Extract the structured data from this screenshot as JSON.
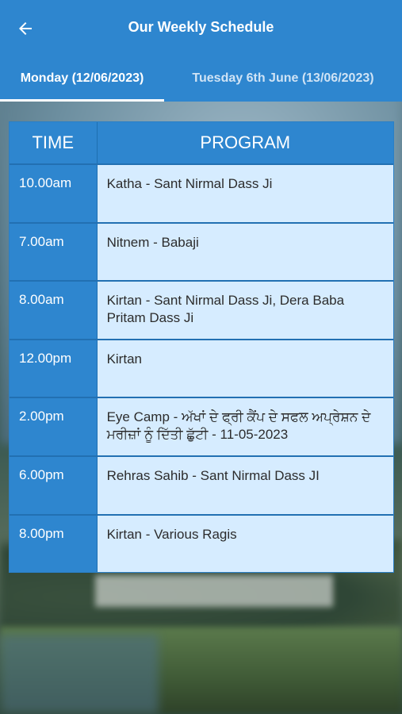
{
  "header": {
    "title": "Our Weekly Schedule",
    "back_icon": "arrow-left-icon"
  },
  "tabs": [
    {
      "label": "Monday (12/06/2023)",
      "selected": true
    },
    {
      "label": "Tuesday 6th June (13/06/2023)",
      "selected": false
    }
  ],
  "table": {
    "headers": {
      "time": "TIME",
      "program": "PROGRAM"
    },
    "rows": [
      {
        "time": "10.00am",
        "program": "Katha - Sant Nirmal Dass Ji"
      },
      {
        "time": "7.00am",
        "program": "Nitnem - Babaji"
      },
      {
        "time": "8.00am",
        "program": "Kirtan - Sant Nirmal Dass Ji, Dera Baba Pritam Dass Ji"
      },
      {
        "time": "12.00pm",
        "program": "Kirtan"
      },
      {
        "time": "2.00pm",
        "program": "Eye Camp - ਅੱਖਾਂ ਦੇ ਫ੍ਰੀ ਕੈਂਪ ਦੇ ਸਫਲ ਅਪ੍ਰੇਸ਼ਨ ਦੇ ਮਰੀਜ਼ਾਂ ਨੂੰ ਦਿੱਤੀ ਛੁੱਟੀ - 11-05-2023"
      },
      {
        "time": "6.00pm",
        "program": "Rehras Sahib - Sant Nirmal Dass JI"
      },
      {
        "time": "8.00pm",
        "program": "Kirtan - Various Ragis"
      }
    ]
  },
  "colors": {
    "primary": "#2e86cf",
    "cell_light": "#d6ecff"
  }
}
